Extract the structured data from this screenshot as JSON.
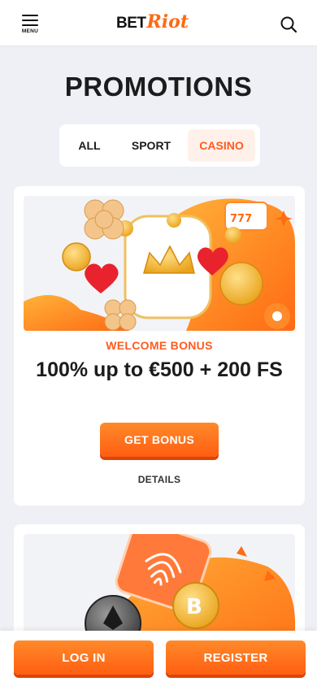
{
  "header": {
    "menu_label": "MENU",
    "logo_bet": "BET",
    "logo_riot": "Riot"
  },
  "page": {
    "title": "PROMOTIONS"
  },
  "tabs": [
    {
      "label": "ALL",
      "active": false
    },
    {
      "label": "SPORT",
      "active": false
    },
    {
      "label": "CASINO",
      "active": true
    }
  ],
  "promo": {
    "label": "WELCOME BONUS",
    "title": "100% up to €500 + 200 FS",
    "cta": "GET BONUS",
    "details": "DETAILS"
  },
  "footer": {
    "login": "LOG IN",
    "register": "REGISTER"
  },
  "colors": {
    "accent": "#ff5b1f",
    "accent_light": "#ff8a2a",
    "background": "#eef0f5"
  },
  "icons": {
    "menu": "hamburger-icon",
    "search": "search-icon"
  }
}
